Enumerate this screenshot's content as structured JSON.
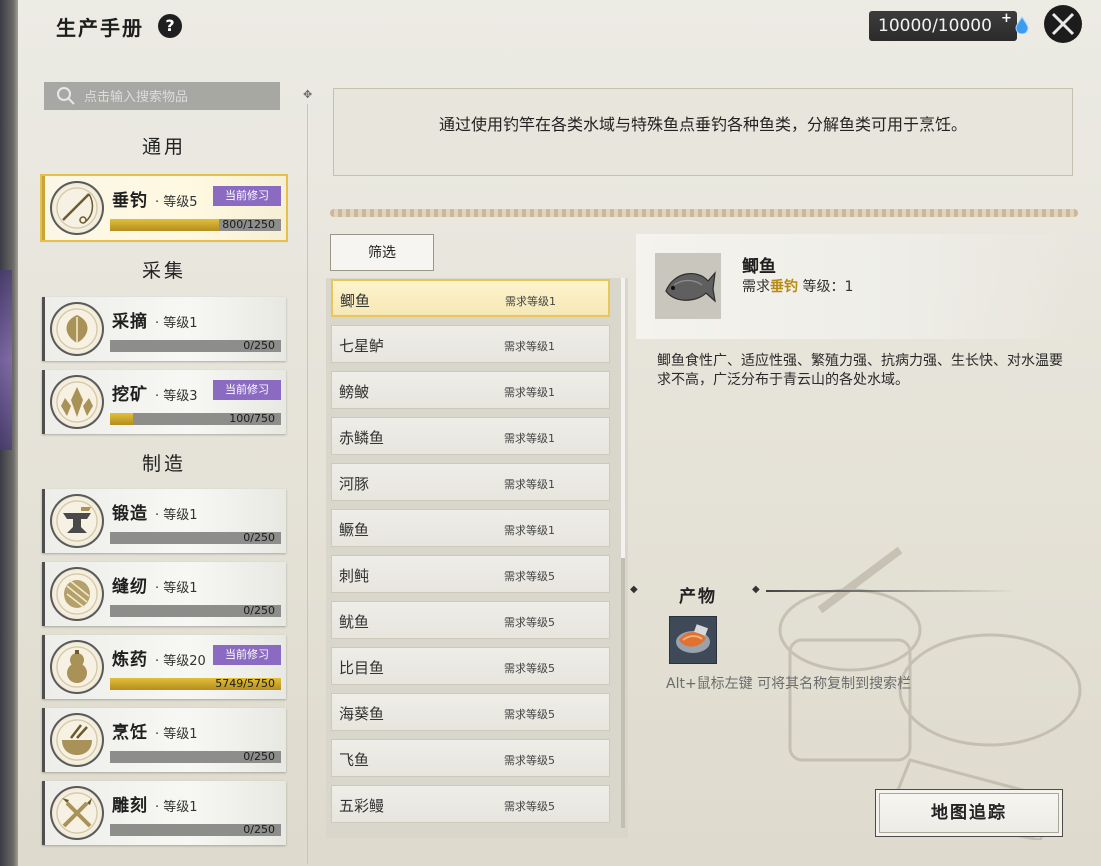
{
  "header": {
    "title": "生产手册",
    "help_icon": "question-icon",
    "currency_value": "10000/10000",
    "currency_plus": "+",
    "close_icon": "close-icon"
  },
  "search": {
    "placeholder": "点击输入搜索物品"
  },
  "sections": {
    "general": "通用",
    "gather": "采集",
    "craft": "制造"
  },
  "skills": [
    {
      "name": "垂钓",
      "level": "· 等级5",
      "badge": "当前修习",
      "progress": "800/1250",
      "fraction": 0.64,
      "active": true,
      "icon": "fishing-rod-icon"
    },
    {
      "name": "采摘",
      "level": "· 等级1",
      "badge": "",
      "progress": "0/250",
      "fraction": 0.0,
      "active": false,
      "icon": "leaf-icon"
    },
    {
      "name": "挖矿",
      "level": "· 等级3",
      "badge": "当前修习",
      "progress": "100/750",
      "fraction": 0.133,
      "active": false,
      "icon": "ore-crystal-icon"
    },
    {
      "name": "锻造",
      "level": "· 等级1",
      "badge": "",
      "progress": "0/250",
      "fraction": 0.0,
      "active": false,
      "icon": "anvil-icon"
    },
    {
      "name": "缝纫",
      "level": "· 等级1",
      "badge": "",
      "progress": "0/250",
      "fraction": 0.0,
      "active": false,
      "icon": "thread-spool-icon"
    },
    {
      "name": "炼药",
      "level": "· 等级20",
      "badge": "当前修习",
      "progress": "5749/5750",
      "fraction": 0.9998,
      "active": false,
      "icon": "gourd-icon"
    },
    {
      "name": "烹饪",
      "level": "· 等级1",
      "badge": "",
      "progress": "0/250",
      "fraction": 0.0,
      "active": false,
      "icon": "cooking-bowl-icon"
    },
    {
      "name": "雕刻",
      "level": "· 等级1",
      "badge": "",
      "progress": "0/250",
      "fraction": 0.0,
      "active": false,
      "icon": "carving-tools-icon"
    }
  ],
  "description": "通过使用钓竿在各类水域与特殊鱼点垂钓各种鱼类，分解鱼类可用于烹饪。",
  "filter_label": "筛选",
  "fish_list": [
    {
      "name": "鲫鱼",
      "req": "需求等级1",
      "selected": true
    },
    {
      "name": "七星鲈",
      "req": "需求等级1"
    },
    {
      "name": "鳑鲏",
      "req": "需求等级1"
    },
    {
      "name": "赤鳞鱼",
      "req": "需求等级1"
    },
    {
      "name": "河豚",
      "req": "需求等级1"
    },
    {
      "name": "鳜鱼",
      "req": "需求等级1"
    },
    {
      "name": "刺鲀",
      "req": "需求等级5"
    },
    {
      "name": "鱿鱼",
      "req": "需求等级5"
    },
    {
      "name": "比目鱼",
      "req": "需求等级5"
    },
    {
      "name": "海葵鱼",
      "req": "需求等级5"
    },
    {
      "name": "飞鱼",
      "req": "需求等级5"
    },
    {
      "name": "五彩鳗",
      "req": "需求等级5"
    }
  ],
  "detail": {
    "name": "鲫鱼",
    "req_prefix": "需求",
    "req_skill": "垂钓",
    "req_suffix": "等级：1",
    "description": "鲫鱼食性广、适应性强、繁殖力强、抗病力强、生长快、对水温要求不高，广泛分布于青云山的各处水域。",
    "products_title": "产物",
    "product_icon": "fish-fillet-icon",
    "hint": "Alt+鼠标左键 可将其名称复制到搜索栏",
    "track_button": "地图追踪"
  },
  "colors": {
    "accent_gold": "#e2bf3a",
    "badge_purple": "#8a6bc1",
    "highlight": "#b68a12"
  }
}
